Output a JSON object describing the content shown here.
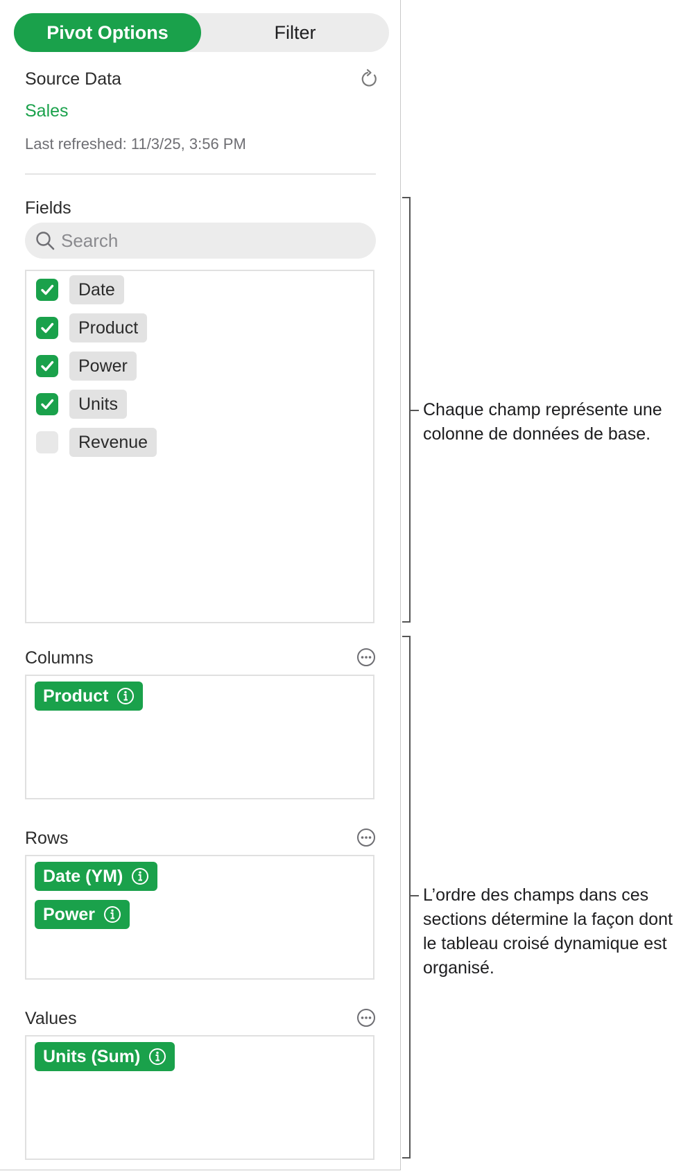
{
  "tabs": {
    "pivot_options": "Pivot Options",
    "filter": "Filter"
  },
  "source": {
    "title": "Source Data",
    "name": "Sales",
    "last_refreshed": "Last refreshed: 11/3/25, 3:56 PM"
  },
  "fields": {
    "title": "Fields",
    "search_placeholder": "Search",
    "items": [
      {
        "label": "Date",
        "checked": true
      },
      {
        "label": "Product",
        "checked": true
      },
      {
        "label": "Power",
        "checked": true
      },
      {
        "label": "Units",
        "checked": true
      },
      {
        "label": "Revenue",
        "checked": false
      }
    ]
  },
  "columns": {
    "title": "Columns",
    "items": [
      "Product"
    ]
  },
  "rows": {
    "title": "Rows",
    "items": [
      "Date (YM)",
      "Power"
    ]
  },
  "values": {
    "title": "Values",
    "items": [
      "Units (Sum)"
    ]
  },
  "annotations": {
    "fields": "Chaque champ représente une colonne de données de base.",
    "sections": "L’ordre des champs dans ces sections détermine la façon dont le tableau croisé dynamique est organisé."
  },
  "colors": {
    "accent": "#1aa14b",
    "chip_gray": "#e2e2e2",
    "segment_bg": "#ececec"
  },
  "icons": [
    "refresh-icon",
    "search-icon",
    "checkmark-icon",
    "info-icon",
    "more-icon"
  ]
}
